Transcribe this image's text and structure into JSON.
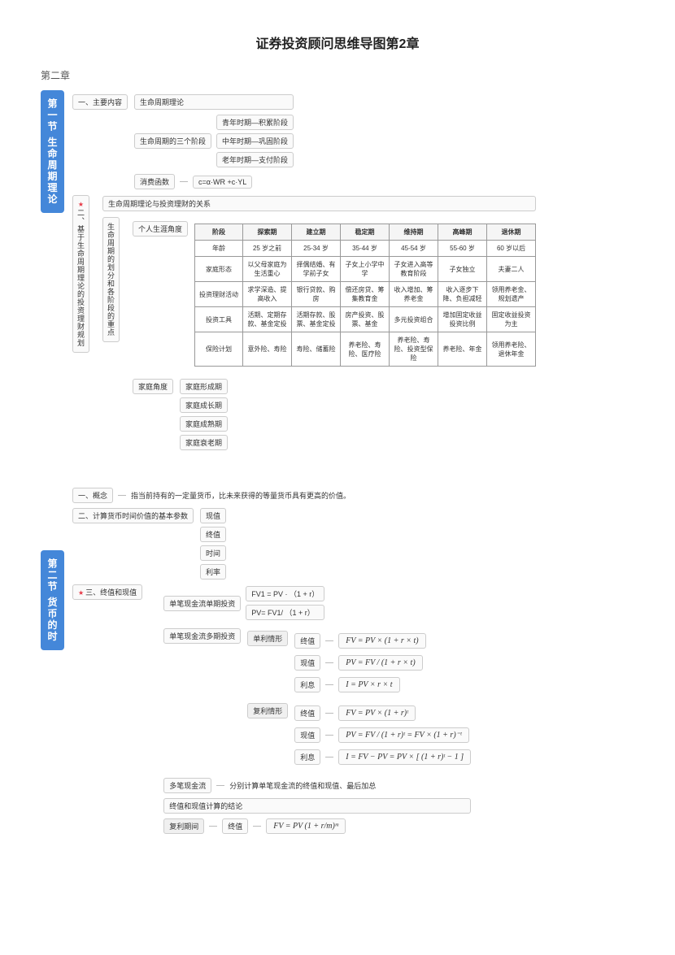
{
  "title": "证券投资顾问思维导图第2章",
  "chapter": "第二章",
  "section1": {
    "title": "第一节 生命周期理论",
    "main": {
      "label": "一、主要内容",
      "items": [
        "生命周期理论",
        "生命周期的三个阶段",
        "消费函数"
      ],
      "stages": [
        "青年时期—积累阶段",
        "中年时期—巩固阶段",
        "老年时期—支付阶段"
      ],
      "formula": "c=α·WR +c·YL"
    },
    "plan": {
      "label": "二、基于生命周期理论的投资理财规划",
      "sub1": "生命周期理论与投资理财的关系",
      "sub2": "生命周期的划分和各阶段的重点",
      "perspective1": "个人生涯角度",
      "perspective2": "家庭角度",
      "family": [
        "家庭形成期",
        "家庭成长期",
        "家庭成熟期",
        "家庭衰老期"
      ]
    },
    "table": {
      "headers": [
        "阶段",
        "探索期",
        "建立期",
        "稳定期",
        "维持期",
        "高峰期",
        "退休期"
      ],
      "rows": [
        [
          "年龄",
          "25 岁之前",
          "25-34 岁",
          "35-44 岁",
          "45-54 岁",
          "55-60 岁",
          "60 岁以后"
        ],
        [
          "家庭形态",
          "以父母家庭为生活重心",
          "择偶结婚、有学前子女",
          "子女上小学中学",
          "子女进入高等教育阶段",
          "子女独立",
          "夫妻二人"
        ],
        [
          "投资理财活动",
          "求学深造、提高收入",
          "银行贷款、购房",
          "偿还房贷、筹集教育金",
          "收入增加、筹养老金",
          "收入逐步下降、负担减轻",
          "领用养老金、规划遗产"
        ],
        [
          "投资工具",
          "活期、定期存款、基金定投",
          "活期存款、股票、基金定投",
          "房产投资、股票、基金",
          "多元投资组合",
          "增加固定收益投资比例",
          "固定收益投资为主"
        ],
        [
          "保险计划",
          "意外险、寿险",
          "寿险、储蓄险",
          "养老险、寿险、医疗险",
          "养老险、寿险、投资型保险",
          "养老险、年金",
          "领用养老险、退休年金"
        ]
      ]
    }
  },
  "section2": {
    "title": "第二节 货币的时",
    "concept": {
      "label": "一、概念",
      "text": "指当前持有的一定量货币，比未来获得的等量货币具有更高的价值。"
    },
    "params": {
      "label": "二、计算货币时间价值的基本参数",
      "items": [
        "现值",
        "终值",
        "时间",
        "利率"
      ]
    },
    "fvpv": {
      "label": "三、终值和现值",
      "single1": {
        "label": "单笔现金流单期投资",
        "f": [
          "FV1 = PV · （1 + r）",
          "PV= FV1/ （1 + r）"
        ]
      },
      "single2": {
        "label": "单笔现金流多期投资",
        "simple": {
          "label": "单利情形",
          "items": [
            {
              "k": "终值",
              "f": "FV = PV × (1 + r × t)"
            },
            {
              "k": "现值",
              "f": "PV = FV / (1 + r × t)"
            },
            {
              "k": "利息",
              "f": "I = PV × r × t"
            }
          ]
        },
        "compound": {
          "label": "复利情形",
          "items": [
            {
              "k": "终值",
              "f": "FV = PV × (1 + r)ᵗ"
            },
            {
              "k": "现值",
              "f": "PV = FV / (1 + r)ᵗ = FV × (1 + r)⁻ᵗ"
            },
            {
              "k": "利息",
              "f": "I = FV − PV = PV × [ (1 + r)ᵗ − 1 ]"
            }
          ]
        }
      },
      "multi": {
        "label": "多笔现金流",
        "text": "分别计算单笔现金流的终值和现值、最后加总"
      },
      "conclusion": "终值和现值计算的结论",
      "period": {
        "label": "复利期间",
        "k": "终值",
        "f": "FV = PV (1 + r/m)ᵐ"
      }
    }
  }
}
